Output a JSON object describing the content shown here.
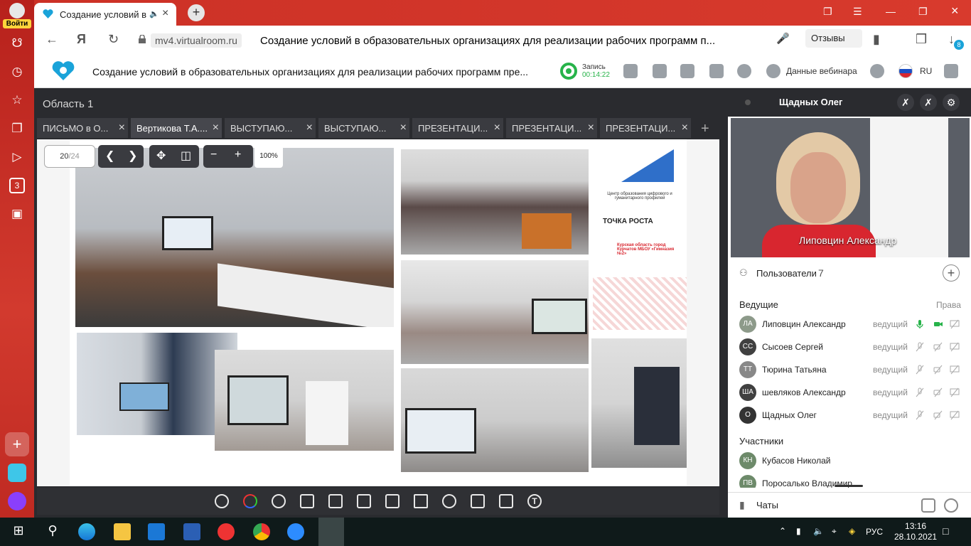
{
  "browser": {
    "login_label": "Войти",
    "tab_title": "Создание условий в",
    "url": "mv4.virtualroom.ru",
    "page_title": "Создание условий в образовательных организациях для реализации рабочих программ п...",
    "reviews_label": "Отзывы",
    "downloads_badge": "8",
    "sidebar_badge": "3"
  },
  "app": {
    "title": "Создание условий в образовательных организациях для реализации рабочих программ пре...",
    "record_label": "Запись",
    "record_time": "00:14:22",
    "webinar_data_label": "Данные вебинара",
    "language": "RU"
  },
  "area": {
    "title": "Область 1",
    "tabs": [
      {
        "label": "ПИСЬМО в О..."
      },
      {
        "label": "Вертикова Т.А...."
      },
      {
        "label": "ВЫСТУПАЮ..."
      },
      {
        "label": "ВЫСТУПАЮ..."
      },
      {
        "label": "ПРЕЗЕНТАЦИ..."
      },
      {
        "label": "ПРЕЗЕНТАЦИ..."
      },
      {
        "label": "ПРЕЗЕНТАЦИ..."
      }
    ],
    "active_tab": 1,
    "page_current": "20",
    "page_total": "/24",
    "zoom": "100%"
  },
  "slide": {
    "banner_text": "Центр образования цифрового и гуманитарного профилей",
    "brand": "ТОЧКА РОСТА",
    "location_text": "Курская область город Курчатов МБОУ «Гимназия №2»"
  },
  "speaker": {
    "header_name": "Щадных Олег",
    "video_name": "Липовцин Александр"
  },
  "users": {
    "title": "Пользователи",
    "count": "7",
    "hosts_label": "Ведущие",
    "rights_label": "Права",
    "participants_label": "Участники",
    "hosts": [
      {
        "initials": "ЛА",
        "name": "Липовцин Александр",
        "role": "ведущий",
        "active": true
      },
      {
        "initials": "СС",
        "name": "Сысоев Сергей",
        "role": "ведущий",
        "active": false
      },
      {
        "initials": "ТТ",
        "name": "Тюрина Татьяна",
        "role": "ведущий",
        "active": false
      },
      {
        "initials": "ША",
        "name": "шевляков Александр",
        "role": "ведущий",
        "active": false
      },
      {
        "initials": "О",
        "name": "Щадных Олег",
        "role": "ведущий",
        "active": false
      }
    ],
    "participants": [
      {
        "initials": "КН",
        "name": "Кубасов Николай"
      },
      {
        "initials": "ПВ",
        "name": "Поросалько Владимир"
      }
    ]
  },
  "chats": {
    "label": "Чаты"
  },
  "taskbar": {
    "lang": "РУС",
    "time": "13:16",
    "date": "28.10.2021"
  },
  "colors": {
    "browser_red": "#d3342a",
    "record_green": "#27b34a",
    "dark_bg": "#2a2b2f",
    "brand_red": "#d8262f"
  }
}
